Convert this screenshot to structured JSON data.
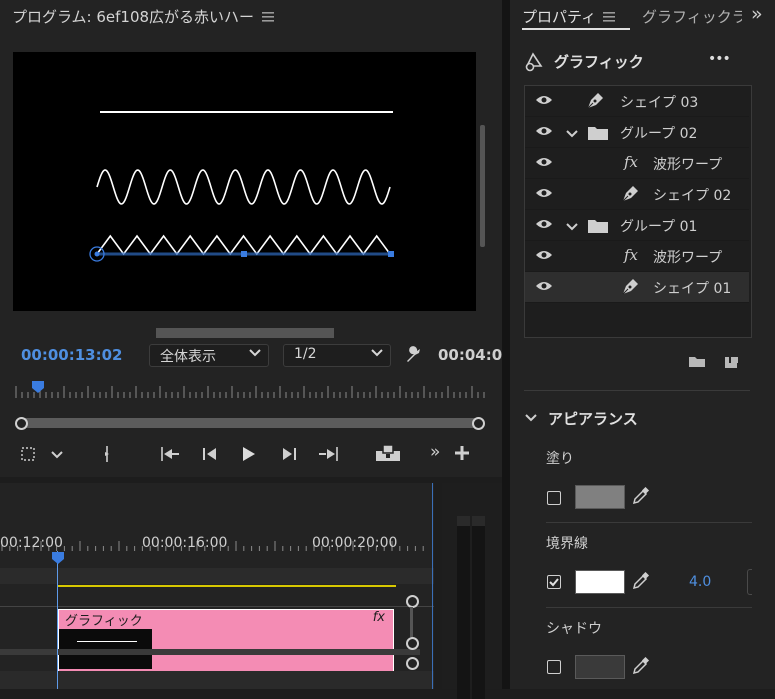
{
  "program_monitor": {
    "title": "プログラム: 6ef108広がる赤いハー",
    "menu_icon": "hamburger-icon",
    "timecode_current": "00:00:13:02",
    "fit_select": "全体表示",
    "resolution_select": "1/2",
    "timecode_duration": "00:04:0",
    "transport": [
      "marker-icon",
      "go-to-in-icon",
      "step-back-icon",
      "play-icon",
      "step-forward-icon",
      "go-to-out-icon",
      "export-frame-icon",
      "more-icon",
      "add-icon"
    ]
  },
  "timeline": {
    "timecodes": [
      "00:12:00",
      "00:00:16:00",
      "00:00:20:00"
    ],
    "clip_label": "グラフィック",
    "clip_fx": "fx",
    "clip_color": "#f48cb4"
  },
  "properties": {
    "tabs": [
      "プロパティ",
      "グラフィックラ"
    ],
    "section_title": "グラフィック",
    "more_label": "•••",
    "layers": [
      {
        "label": "シェイプ 03",
        "type": "shape"
      },
      {
        "label": "グループ 02",
        "type": "group"
      },
      {
        "label": "波形ワープ",
        "type": "fx"
      },
      {
        "label": "シェイプ 02",
        "type": "shape"
      },
      {
        "label": "グループ 01",
        "type": "group"
      },
      {
        "label": "波形ワープ",
        "type": "fx"
      },
      {
        "label": "シェイプ 01",
        "type": "shape"
      }
    ],
    "appearance": {
      "title": "アピアランス",
      "fill_label": "塗り",
      "fill_checked": false,
      "fill_color": "#808080",
      "stroke_label": "境界線",
      "stroke_checked": true,
      "stroke_color": "#ffffff",
      "stroke_width": "4.0",
      "shadow_label": "シャドウ",
      "shadow_checked": false,
      "shadow_color": "#3a3a3a"
    }
  },
  "accent_color": "#4f8fe0"
}
